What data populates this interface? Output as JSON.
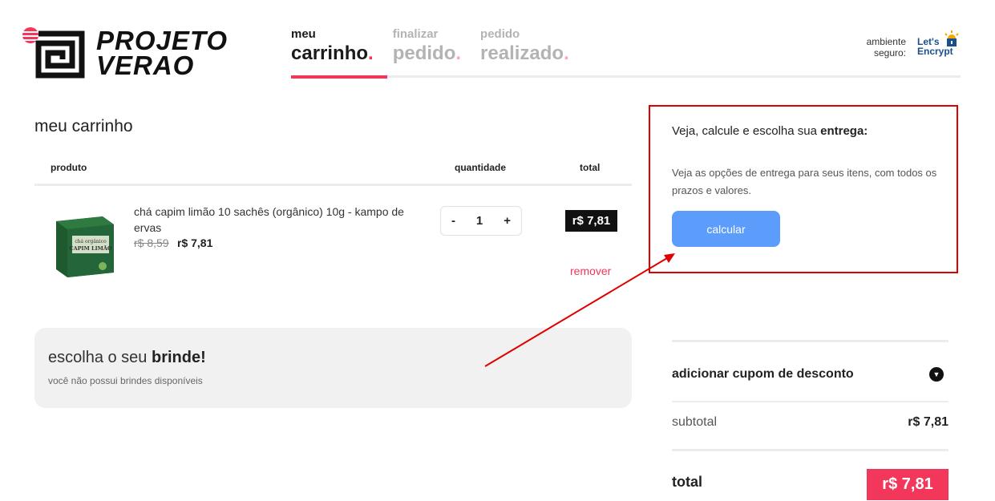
{
  "header": {
    "logo_text": "PROJETO VERAO",
    "steps": [
      {
        "small": "meu",
        "big": "carrinho",
        "dot": "."
      },
      {
        "small": "finalizar",
        "big": "pedido",
        "dot": "."
      },
      {
        "small": "pedido",
        "big": "realizado",
        "dot": "."
      }
    ],
    "secure_line1": "ambiente",
    "secure_line2": "seguro:",
    "lets_encrypt_line1": "Let's",
    "lets_encrypt_line2": "Encrypt"
  },
  "cart": {
    "title": "meu carrinho",
    "columns": {
      "product": "produto",
      "quantity": "quantidade",
      "total": "total"
    },
    "item": {
      "name": "chá capim limão 10 sachês (orgânico) 10g - kampo de ervas",
      "image_label_line1": "chá orgânico",
      "image_label_line2": "CAPIM LIMÃO",
      "old_price": "r$ 8,59",
      "price": "r$ 7,81",
      "quantity": "1",
      "minus": "-",
      "plus": "+",
      "line_total": "r$ 7,81",
      "remove_label": "remover"
    },
    "gift": {
      "title_prefix": "escolha o seu",
      "title_bold": "brinde!",
      "subtitle": "você não possui brindes disponíveis"
    }
  },
  "shipping": {
    "title_prefix": "Veja, calcule e escolha sua",
    "title_bold": "entrega:",
    "description": "Veja as opções de entrega para seus itens, com todos os prazos e valores.",
    "button_label": "calcular"
  },
  "summary": {
    "coupon_label": "adicionar cupom de desconto",
    "coupon_toggle": "▼",
    "subtotal_label": "subtotal",
    "subtotal_value": "r$ 7,81",
    "total_label": "total",
    "total_value": "r$ 7,81"
  },
  "colors": {
    "accent": "#f2375b",
    "button": "#5c9dfb",
    "highlight_box": "#e00000"
  }
}
